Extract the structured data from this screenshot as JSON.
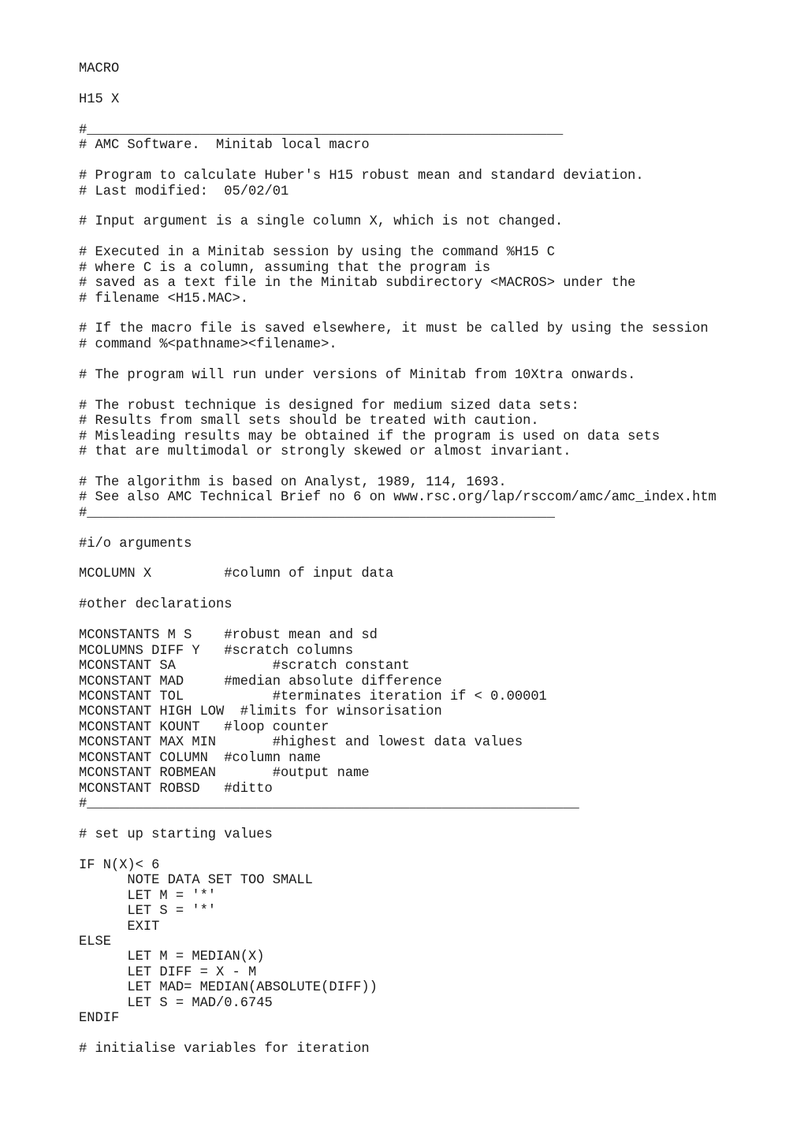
{
  "document": {
    "lines": [
      "MACRO",
      "",
      "H15 X",
      "",
      "#___________________________________________________________",
      "# AMC Software.  Minitab local macro",
      "",
      "# Program to calculate Huber's H15 robust mean and standard deviation.",
      "# Last modified:  05/02/01",
      "",
      "# Input argument is a single column X, which is not changed.",
      "",
      "# Executed in a Minitab session by using the command %H15 C",
      "# where C is a column, assuming that the program is",
      "# saved as a text file in the Minitab subdirectory <MACROS> under the",
      "# filename <H15.MAC>.",
      "",
      "# If the macro file is saved elsewhere, it must be called by using the session",
      "# command %<pathname><filename>.",
      "",
      "# The program will run under versions of Minitab from 10Xtra onwards.",
      "",
      "# The robust technique is designed for medium sized data sets:",
      "# Results from small sets should be treated with caution.",
      "# Misleading results may be obtained if the program is used on data sets",
      "# that are multimodal or strongly skewed or almost invariant.",
      "",
      "# The algorithm is based on Analyst, 1989, 114, 1693.",
      "# See also AMC Technical Brief no 6 on www.rsc.org/lap/rsccom/amc/amc_index.htm",
      "#__________________________________________________________",
      "",
      "#i/o arguments",
      "",
      "MCOLUMN X         #column of input data",
      "",
      "#other declarations",
      "",
      "MCONSTANTS M S    #robust mean and sd",
      "MCOLUMNS DIFF Y   #scratch columns",
      "MCONSTANT SA            #scratch constant",
      "MCONSTANT MAD     #median absolute difference",
      "MCONSTANT TOL           #terminates iteration if < 0.00001",
      "MCONSTANT HIGH LOW  #limits for winsorisation",
      "MCONSTANT KOUNT   #loop counter",
      "MCONSTANT MAX MIN       #highest and lowest data values",
      "MCONSTANT COLUMN  #column name",
      "MCONSTANT ROBMEAN       #output name",
      "MCONSTANT ROBSD   #ditto",
      "#_____________________________________________________________",
      "",
      "# set up starting values",
      "",
      "IF N(X)< 6",
      "      NOTE DATA SET TOO SMALL",
      "      LET M = '*'",
      "      LET S = '*'",
      "      EXIT",
      "ELSE",
      "      LET M = MEDIAN(X)",
      "      LET DIFF = X - M",
      "      LET MAD= MEDIAN(ABSOLUTE(DIFF))",
      "      LET S = MAD/0.6745",
      "ENDIF",
      "",
      "# initialise variables for iteration"
    ]
  }
}
